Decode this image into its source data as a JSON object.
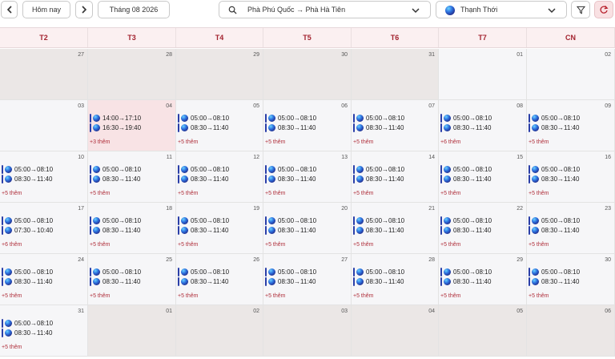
{
  "toolbar": {
    "today_label": "Hôm nay",
    "month_label": "Tháng 08 2026",
    "route_label": "Phà Phú Quốc → Phà Hà Tiên",
    "vessel_label": "Thạnh Thới"
  },
  "weekdays": [
    "T2",
    "T3",
    "T4",
    "T5",
    "T6",
    "T7",
    "CN"
  ],
  "weeks": [
    {
      "days": [
        {
          "num": "27",
          "other": true,
          "events": [],
          "more": ""
        },
        {
          "num": "28",
          "other": true,
          "events": [],
          "more": ""
        },
        {
          "num": "29",
          "other": true,
          "events": [],
          "more": ""
        },
        {
          "num": "30",
          "other": true,
          "events": [],
          "more": ""
        },
        {
          "num": "31",
          "other": true,
          "events": [],
          "more": ""
        },
        {
          "num": "01",
          "events": [],
          "more": ""
        },
        {
          "num": "02",
          "events": [],
          "more": ""
        }
      ]
    },
    {
      "days": [
        {
          "num": "03",
          "events": [],
          "more": ""
        },
        {
          "num": "04",
          "selected": true,
          "events": [
            "14:00→17:10",
            "16:30→19:40"
          ],
          "more": "+3 thêm"
        },
        {
          "num": "05",
          "events": [
            "05:00→08:10",
            "08:30→11:40"
          ],
          "more": "+5 thêm"
        },
        {
          "num": "06",
          "events": [
            "05:00→08:10",
            "08:30→11:40"
          ],
          "more": "+5 thêm"
        },
        {
          "num": "07",
          "events": [
            "05:00→08:10",
            "08:30→11:40"
          ],
          "more": "+5 thêm"
        },
        {
          "num": "08",
          "events": [
            "05:00→08:10",
            "08:30→11:40"
          ],
          "more": "+6 thêm"
        },
        {
          "num": "09",
          "events": [
            "05:00→08:10",
            "08:30→11:40"
          ],
          "more": "+5 thêm"
        }
      ]
    },
    {
      "days": [
        {
          "num": "10",
          "events": [
            "05:00→08:10",
            "08:30→11:40"
          ],
          "more": "+5 thêm"
        },
        {
          "num": "11",
          "events": [
            "05:00→08:10",
            "08:30→11:40"
          ],
          "more": "+5 thêm"
        },
        {
          "num": "12",
          "events": [
            "05:00→08:10",
            "08:30→11:40"
          ],
          "more": "+5 thêm"
        },
        {
          "num": "13",
          "events": [
            "05:00→08:10",
            "08:30→11:40"
          ],
          "more": "+5 thêm"
        },
        {
          "num": "14",
          "events": [
            "05:00→08:10",
            "08:30→11:40"
          ],
          "more": "+5 thêm"
        },
        {
          "num": "15",
          "events": [
            "05:00→08:10",
            "08:30→11:40"
          ],
          "more": "+5 thêm"
        },
        {
          "num": "16",
          "events": [
            "05:00→08:10",
            "08:30→11:40"
          ],
          "more": "+5 thêm"
        }
      ]
    },
    {
      "days": [
        {
          "num": "17",
          "events": [
            "05:00→08:10",
            "07:30→10:40"
          ],
          "more": "+6 thêm"
        },
        {
          "num": "18",
          "events": [
            "05:00→08:10",
            "08:30→11:40"
          ],
          "more": "+5 thêm"
        },
        {
          "num": "19",
          "events": [
            "05:00→08:10",
            "08:30→11:40"
          ],
          "more": "+5 thêm"
        },
        {
          "num": "20",
          "events": [
            "05:00→08:10",
            "08:30→11:40"
          ],
          "more": "+5 thêm"
        },
        {
          "num": "21",
          "events": [
            "05:00→08:10",
            "08:30→11:40"
          ],
          "more": "+5 thêm"
        },
        {
          "num": "22",
          "events": [
            "05:00→08:10",
            "08:30→11:40"
          ],
          "more": "+5 thêm"
        },
        {
          "num": "23",
          "events": [
            "05:00→08:10",
            "08:30→11:40"
          ],
          "more": "+5 thêm"
        }
      ]
    },
    {
      "days": [
        {
          "num": "24",
          "events": [
            "05:00→08:10",
            "08:30→11:40"
          ],
          "more": "+5 thêm"
        },
        {
          "num": "25",
          "events": [
            "05:00→08:10",
            "08:30→11:40"
          ],
          "more": "+5 thêm"
        },
        {
          "num": "26",
          "events": [
            "05:00→08:10",
            "08:30→11:40"
          ],
          "more": "+5 thêm"
        },
        {
          "num": "27",
          "events": [
            "05:00→08:10",
            "08:30→11:40"
          ],
          "more": "+5 thêm"
        },
        {
          "num": "28",
          "events": [
            "05:00→08:10",
            "08:30→11:40"
          ],
          "more": "+5 thêm"
        },
        {
          "num": "29",
          "events": [
            "05:00→08:10",
            "08:30→11:40"
          ],
          "more": "+5 thêm"
        },
        {
          "num": "30",
          "events": [
            "05:00→08:10",
            "08:30→11:40"
          ],
          "more": "+5 thêm"
        }
      ]
    },
    {
      "days": [
        {
          "num": "31",
          "events": [
            "05:00→08:10",
            "08:30→11:40"
          ],
          "more": "+5 thêm"
        },
        {
          "num": "01",
          "other": true,
          "events": [],
          "more": ""
        },
        {
          "num": "02",
          "other": true,
          "events": [],
          "more": ""
        },
        {
          "num": "03",
          "other": true,
          "events": [],
          "more": ""
        },
        {
          "num": "04",
          "other": true,
          "events": [],
          "more": ""
        },
        {
          "num": "05",
          "other": true,
          "events": [],
          "more": ""
        },
        {
          "num": "06",
          "other": true,
          "events": [],
          "more": ""
        }
      ]
    }
  ]
}
